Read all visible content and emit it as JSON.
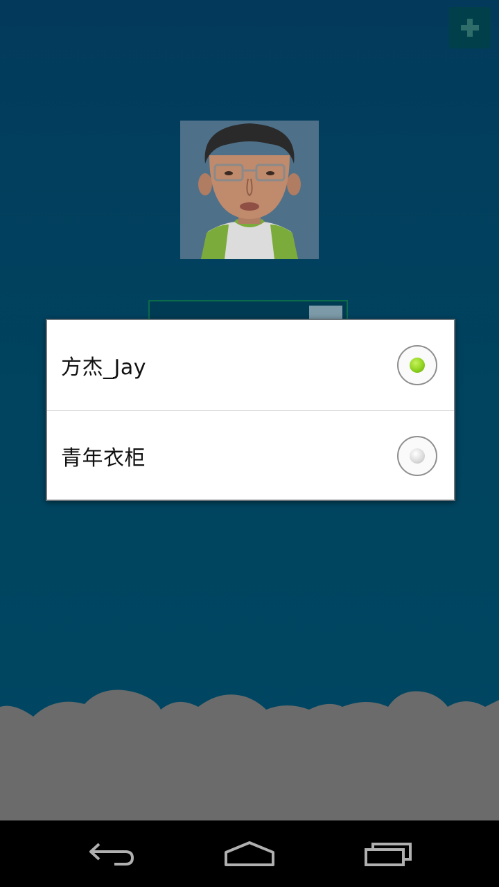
{
  "toolbar": {
    "add_icon": "plus-icon"
  },
  "profile": {
    "avatar_icon": "user-avatar-cartoon"
  },
  "account_dialog": {
    "options": [
      {
        "label": "方杰_Jay",
        "selected": true
      },
      {
        "label": "青年衣柜",
        "selected": false
      }
    ]
  },
  "navbar": {
    "back_icon": "back-icon",
    "home_icon": "home-icon",
    "recents_icon": "recents-icon"
  },
  "colors": {
    "background": "#00445f",
    "radio_selected": "#8fd21f",
    "ground": "#6b6b6b",
    "navbar": "#000000"
  }
}
